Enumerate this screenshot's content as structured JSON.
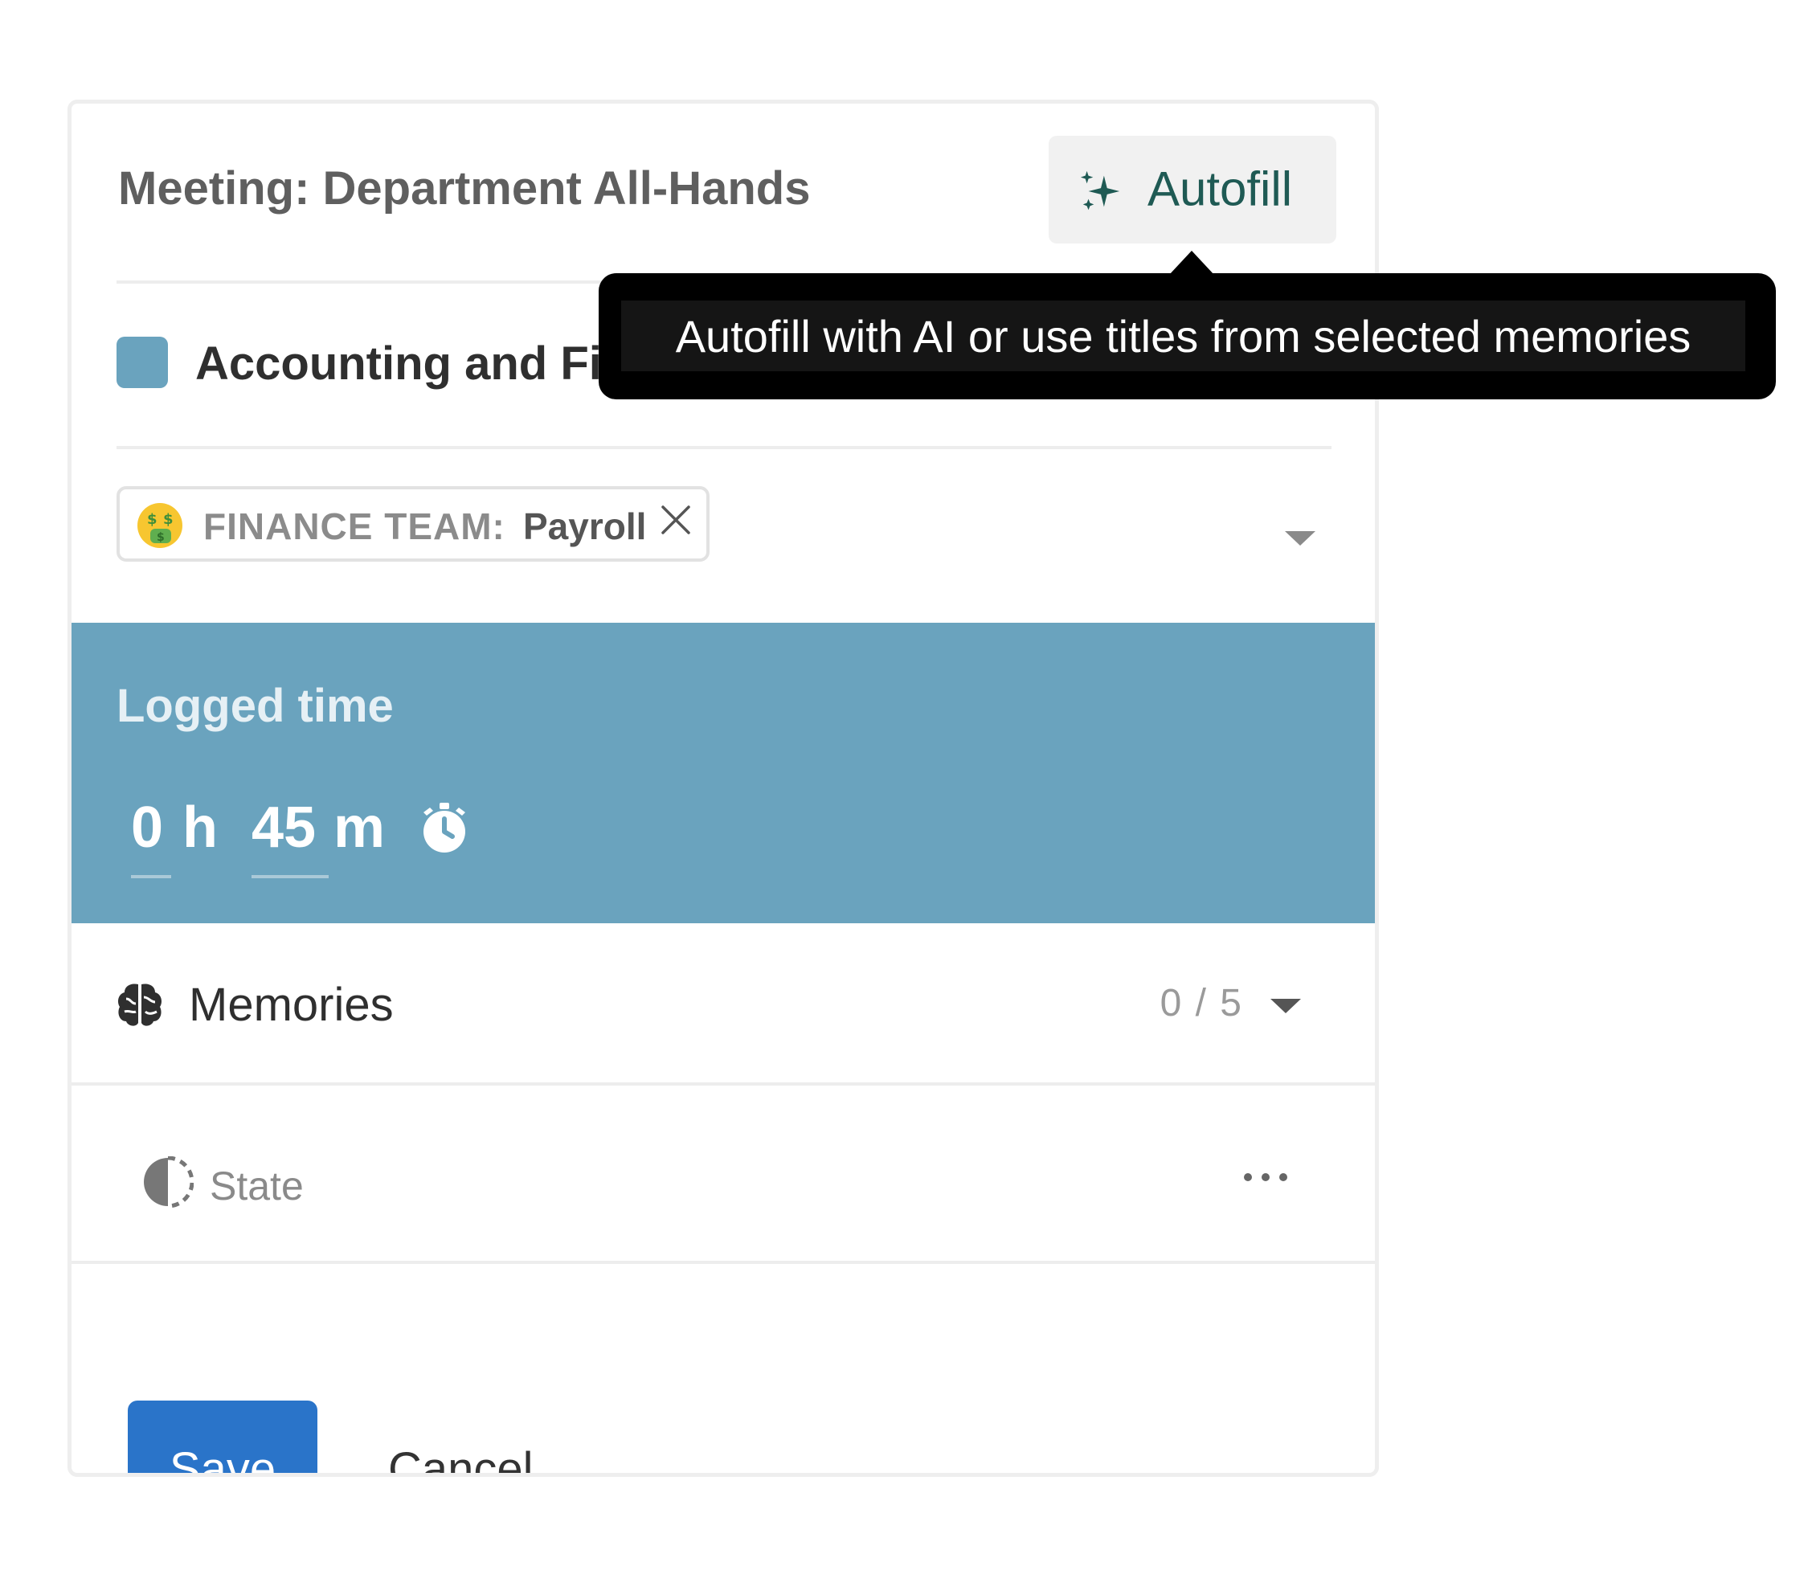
{
  "header": {
    "title": "Meeting: Department All-Hands",
    "autofill_label": "Autofill"
  },
  "tooltip": {
    "text": "Autofill with AI or use titles from selected memories"
  },
  "category": {
    "name": "Accounting and Fi",
    "color": "#6aa3be"
  },
  "tag": {
    "team": "FINANCE TEAM:",
    "value": "Payroll",
    "emoji_icon": "money-mouth-face-icon"
  },
  "logged_time": {
    "label": "Logged time",
    "hours": "0",
    "hours_unit": "h",
    "minutes": "45",
    "minutes_unit": "m"
  },
  "memories": {
    "label": "Memories",
    "count": "0 / 5"
  },
  "state": {
    "label": "State"
  },
  "footer": {
    "save_label": "Save",
    "cancel_label": "Cancel"
  },
  "colors": {
    "accent": "#2a74c9",
    "logged_bg": "#6aa3be",
    "autofill_text": "#1f5a54"
  }
}
